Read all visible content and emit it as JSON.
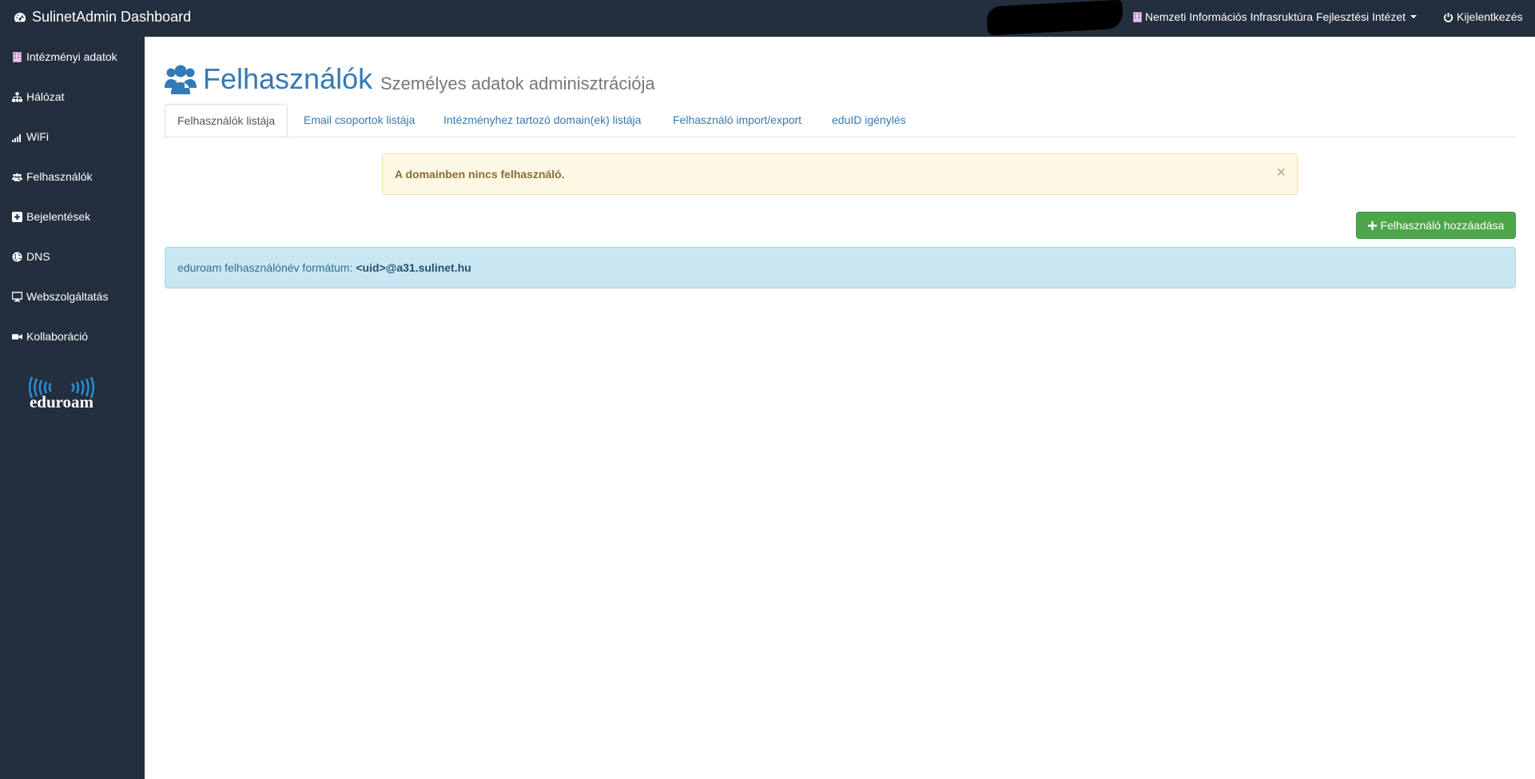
{
  "navbar": {
    "brand": "SulinetAdmin Dashboard",
    "org_name": "Nemzeti Információs Infrasruktúra Fejlesztési Intézet",
    "logout_label": "Kijelentkezés"
  },
  "sidebar": {
    "items": [
      {
        "label": "Intézményi adatok",
        "icon": "building-icon"
      },
      {
        "label": "Hálózat",
        "icon": "sitemap-icon"
      },
      {
        "label": "WiFi",
        "icon": "signal-icon"
      },
      {
        "label": "Felhasználók",
        "icon": "users-icon"
      },
      {
        "label": "Bejelentések",
        "icon": "plus-square-icon"
      },
      {
        "label": "DNS",
        "icon": "globe-icon"
      },
      {
        "label": "Webszolgáltatás",
        "icon": "monitor-icon"
      },
      {
        "label": "Kollaboráció",
        "icon": "video-camera-icon"
      }
    ],
    "logo_text": "eduroam"
  },
  "header": {
    "title": "Felhasználók",
    "subtitle": "Személyes adatok adminisztrációja"
  },
  "tabs": [
    {
      "label": "Felhasználók listája",
      "active": true
    },
    {
      "label": "Email csoportok listája",
      "active": false
    },
    {
      "label": "Intézményhez tartozó domain(ek) listája",
      "active": false
    },
    {
      "label": "Felhasználó import/export",
      "active": false
    },
    {
      "label": "eduID igénylés",
      "active": false
    }
  ],
  "alert": {
    "message": "A domainben nincs felhasználó.",
    "close": "×"
  },
  "add_button": {
    "label": "Felhasználó hozzáadása"
  },
  "info": {
    "prefix": "eduroam felhasználónév formátum:",
    "format": "<uid>@a31.sulinet.hu"
  },
  "colors": {
    "navbar": "#232f3e",
    "link": "#337ab7",
    "success": "#4ea64a",
    "warning_bg": "#fcf8e3",
    "info_bg": "#c9e6f3"
  }
}
